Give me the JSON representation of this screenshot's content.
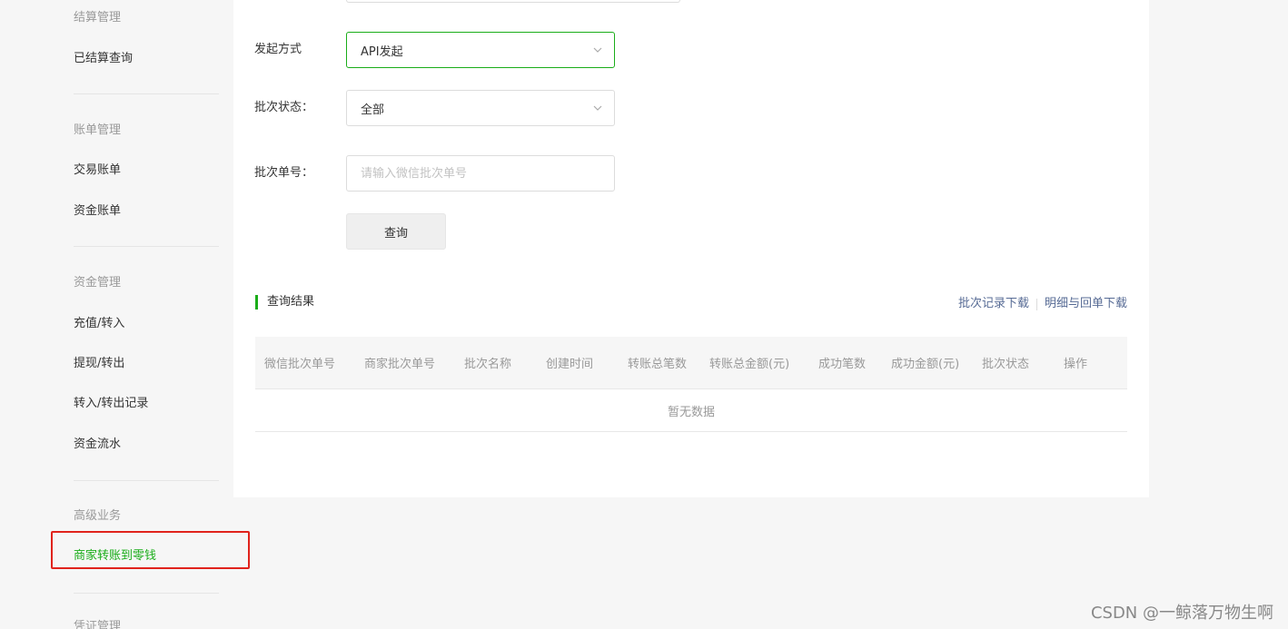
{
  "sidebar": {
    "group_settlement": "结算管理",
    "item_settled_query": "已结算查询",
    "group_bills": "账单管理",
    "item_trade_bill": "交易账单",
    "item_fund_bill": "资金账单",
    "group_funds": "资金管理",
    "item_recharge": "充值/转入",
    "item_withdraw": "提现/转出",
    "item_transfer_records": "转入/转出记录",
    "item_fund_flow": "资金流水",
    "group_advanced": "高级业务",
    "item_merchant_transfer": "商家转账到零钱",
    "group_partial": "凭证管理"
  },
  "form": {
    "initiate_label": "发起方式",
    "initiate_value": "API发起",
    "status_label": "批次状态：",
    "status_value": "全部",
    "batch_no_label": "批次单号：",
    "batch_no_placeholder": "请输入微信批次单号",
    "query_button": "查询"
  },
  "results": {
    "title": "查询结果",
    "download_batch": "批次记录下载",
    "download_detail": "明细与回单下载",
    "columns": [
      "微信批次单号",
      "商家批次单号",
      "批次名称",
      "创建时间",
      "转账总笔数",
      "转账总金额(元)",
      "成功笔数",
      "成功金额(元)",
      "批次状态",
      "操作"
    ],
    "empty_text": "暂无数据"
  },
  "watermark": "CSDN @一鲸落万物生啊",
  "colors": {
    "accent": "#1aad19",
    "link": "#576b95",
    "highlight": "#e0231c"
  }
}
